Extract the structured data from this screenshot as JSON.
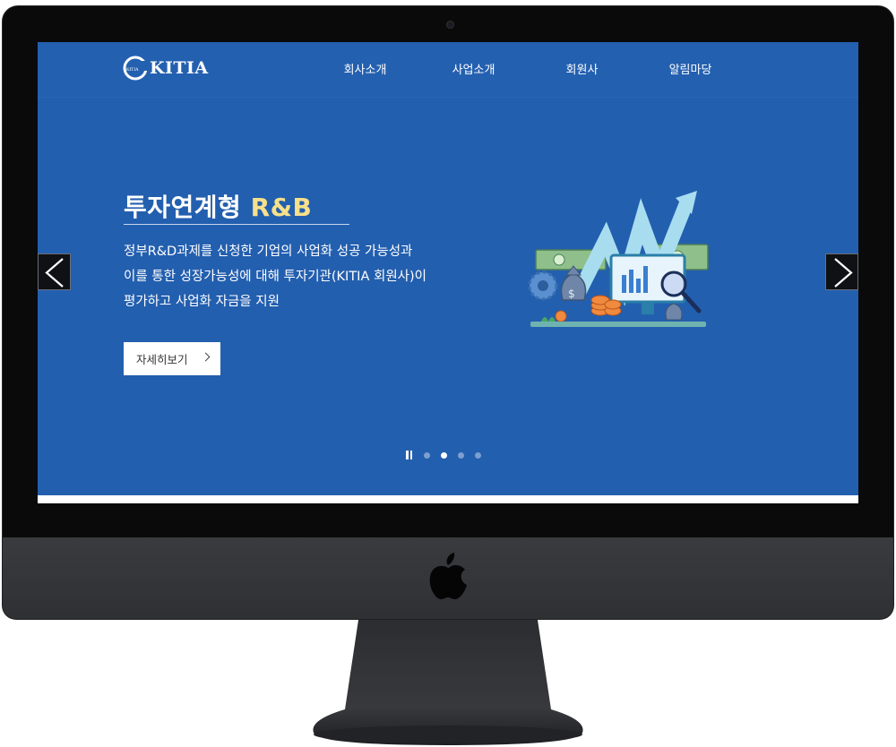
{
  "header": {
    "logo_badge": "KITIA",
    "logo_text": "KITIA",
    "nav": [
      "회사소개",
      "사업소개",
      "회원사",
      "알림마당"
    ]
  },
  "hero": {
    "title_main": "투자연계형",
    "title_accent": "R&B",
    "description": [
      "정부R&D과제를 신청한 기업의 사업화 성공 가능성과",
      "이를 통한 성장가능성에 대해 투자기관(KITIA 회원사)이",
      "평가하고 사업화 자금을 지원"
    ],
    "button_label": "자세히보기"
  },
  "slider": {
    "slide_count": 4,
    "active_index": 1
  },
  "colors": {
    "hero_bg": "#235faf",
    "accent_title": "#f6e08a",
    "device_frame": "#0a0a0a",
    "device_chin": "#35363a"
  },
  "icons": [
    "chevron-left-icon",
    "chevron-right-icon",
    "chevron-right-small-icon",
    "pause-icon",
    "apple-logo-icon",
    "camera-icon"
  ]
}
